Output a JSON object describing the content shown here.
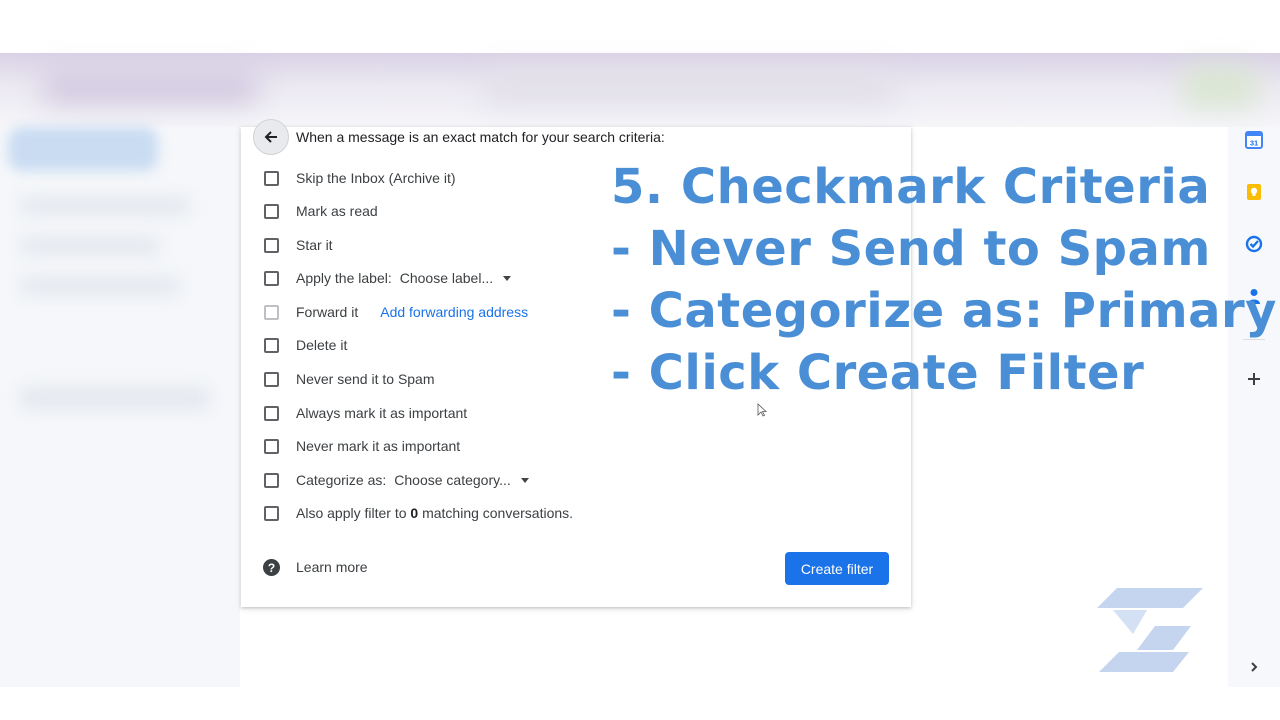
{
  "dialog": {
    "header": "When a message is an exact match for your search criteria:",
    "options": {
      "skip_inbox": "Skip the Inbox (Archive it)",
      "mark_read": "Mark as read",
      "star": "Star it",
      "apply_label": "Apply the label:",
      "apply_label_select": "Choose label...",
      "forward": "Forward it",
      "forward_link": "Add forwarding address",
      "delete": "Delete it",
      "never_spam": "Never send it to Spam",
      "always_important": "Always mark it as important",
      "never_important": "Never mark it as important",
      "categorize": "Categorize as:",
      "categorize_select": "Choose category...",
      "also_apply_prefix": "Also apply filter to",
      "also_apply_count": "0",
      "also_apply_suffix": "matching conversations."
    },
    "learn_more": "Learn more",
    "create_filter": "Create filter"
  },
  "overlay": {
    "line1": "5. Checkmark Criteria",
    "line2": "- Never Send to Spam",
    "line3": "- Categorize as: Primary",
    "line4": "- Click Create Filter"
  },
  "right_rail": {
    "icons": [
      "calendar-icon",
      "keep-icon",
      "tasks-icon",
      "contacts-icon",
      "add-icon",
      "expand-icon"
    ],
    "calendar_day": "31"
  },
  "colors": {
    "accent": "#1a73e8",
    "overlay_text": "#4a8fd6"
  }
}
